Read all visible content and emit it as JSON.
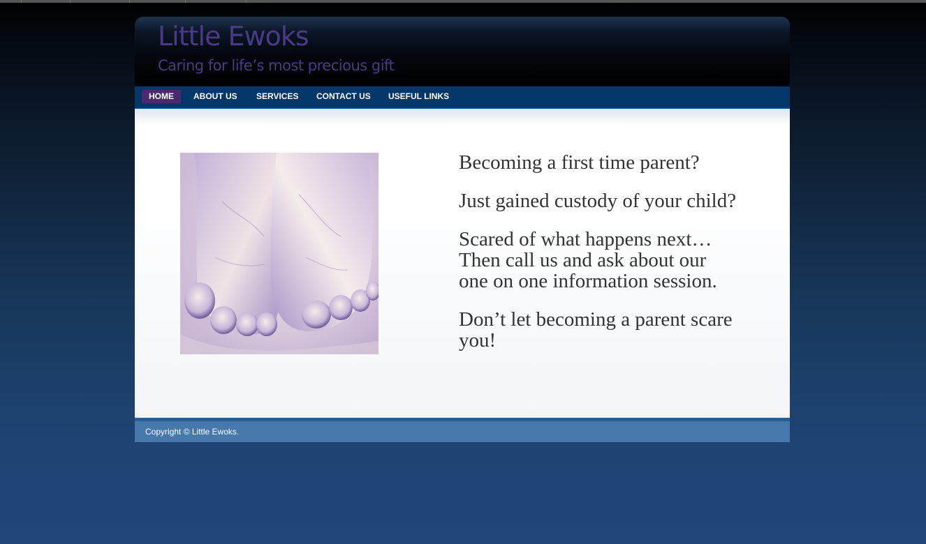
{
  "site": {
    "title": "Little Ewoks",
    "tagline": "Caring for life’s most precious gift"
  },
  "nav": {
    "items": [
      {
        "label": "HOME",
        "active": true
      },
      {
        "label": "ABOUT US",
        "active": false
      },
      {
        "label": "SERVICES",
        "active": false
      },
      {
        "label": "CONTACT US",
        "active": false
      },
      {
        "label": "USEFUL LINKS",
        "active": false
      }
    ]
  },
  "main": {
    "image_icon": "baby-feet-photo",
    "paragraphs": [
      "Becoming a first time parent?",
      "Just gained custody of your child?",
      "Scared of what happens next… Then call us and ask about our one on one information session.",
      "Don’t let becoming a parent scare you!"
    ]
  },
  "footer": {
    "copyright": "Copyright © Little Ewoks."
  },
  "colors": {
    "title_purple": "#4a3a86",
    "nav_blue": "#03376a",
    "nav_active": "#4a2a6e",
    "footer_blue": "#4678ac"
  }
}
